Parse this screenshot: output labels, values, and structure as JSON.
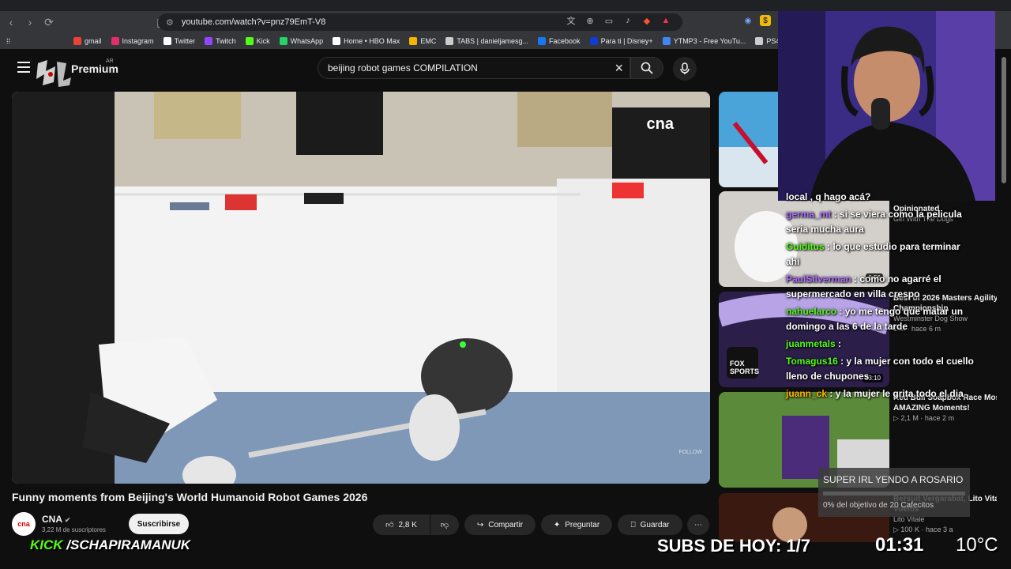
{
  "browser": {
    "url": "youtube.com/watch?v=pnz79EmT-V8",
    "bookmarks": [
      {
        "label": "gmail",
        "icon": "gmail-icon",
        "color": "#ea4335"
      },
      {
        "label": "Instagram",
        "icon": "instagram-icon",
        "color": "#e1306c"
      },
      {
        "label": "Twitter",
        "icon": "x-icon",
        "color": "#ffffff"
      },
      {
        "label": "Twitch",
        "icon": "twitch-icon",
        "color": "#9146ff"
      },
      {
        "label": "Kick",
        "icon": "kick-icon",
        "color": "#53fc18"
      },
      {
        "label": "WhatsApp",
        "icon": "whatsapp-icon",
        "color": "#25d366"
      },
      {
        "label": "Home • HBO Max",
        "icon": "hbo-icon",
        "color": "#ffffff"
      },
      {
        "label": "EMC",
        "icon": "emc-icon",
        "color": "#f4b400"
      },
      {
        "label": "TABS | danieljamesg...",
        "icon": "tabs-icon",
        "color": "#cccccc"
      },
      {
        "label": "Facebook",
        "icon": "facebook-icon",
        "color": "#1877f2"
      },
      {
        "label": "Para ti | Disney+",
        "icon": "disney-icon",
        "color": "#113ccf"
      },
      {
        "label": "YTMP3 - Free YouTu...",
        "icon": "download-icon",
        "color": "#4285f4"
      },
      {
        "label": "PS4 Archives - Dow...",
        "icon": "globe-icon",
        "color": "#cccccc"
      }
    ]
  },
  "youtube": {
    "logo_text": "Premium",
    "country": "AR",
    "search_query": "beijing robot games COMPILATION",
    "video": {
      "title": "Funny moments from Beijing's World Humanoid Robot Games 2026",
      "channel": "CNA",
      "channel_avatar": "cna",
      "subscribers": "3,22 M de suscriptores",
      "subscribe_label": "Suscribirse",
      "likes": "2,8 K",
      "share_label": "Compartir",
      "ask_label": "Preguntar",
      "save_label": "Guardar",
      "watermark": "cna",
      "follow_label": "FOLLOW"
    },
    "recommendations": [
      {
        "title": "",
        "meta": "",
        "duration": ""
      },
      {
        "title": "Opinionated",
        "channel": "Girl With The Dogs",
        "duration": "6:56"
      },
      {
        "title": "Best of 2026 Masters Agility Championship",
        "channel": "Westminster Dog Show",
        "meta": "1 M · hace 6 m",
        "duration": "",
        "badge": "FOX SPORTS"
      },
      {
        "title": "Red Bull Soapbox Race Most AMAZING Moments!",
        "channel": "",
        "meta": "▷ 2,1 M · hace 2 m",
        "duration": "23:10"
      },
      {
        "title": "Bersuit Vergarabat, Lito Vitale | Vuelos",
        "channel": "Lito Vitale",
        "meta": "▷ 100 K · hace 3 a",
        "duration": ""
      }
    ]
  },
  "chat": [
    {
      "user": "",
      "user_color": "#ffffff",
      "text": "local , q hago acá?"
    },
    {
      "user": "germa_mt",
      "user_color": "#a970ff",
      "text": "si se viera como la pelicula seria mucha aura"
    },
    {
      "user": "Guiditus",
      "user_color": "#53fc18",
      "text": "lo que estudio para terminar ahi"
    },
    {
      "user": "PaulSilverman",
      "user_color": "#b06cff",
      "text": "como no agarré el supermercado en villa crespo"
    },
    {
      "user": "nahuelarco",
      "user_color": "#53fc18",
      "text": "yo me tengo que matar un domingo a las 6 de la tarde"
    },
    {
      "user": "juanmetals",
      "user_color": "#53fc18",
      "text": ""
    },
    {
      "user": "Tomagus16",
      "user_color": "#53fc18",
      "text": "y la mujer con todo el cuello lleno de chupones"
    },
    {
      "user": "juann_ck",
      "user_color": "#ffb700",
      "text": "y la mujer le grita todo el dia"
    }
  ],
  "goal": {
    "title": "SUPER IRL YENDO A ROSARIO",
    "progress_text": "0% del objetivo de 20 Cafecitos",
    "progress": 0
  },
  "overlay": {
    "kick_prefix": "KICK",
    "kick_handle": "/SCHAPIRAMANUK",
    "subs_today": "SUBS DE HOY: 1/7",
    "clock": "01:31",
    "temperature": "10°C"
  }
}
